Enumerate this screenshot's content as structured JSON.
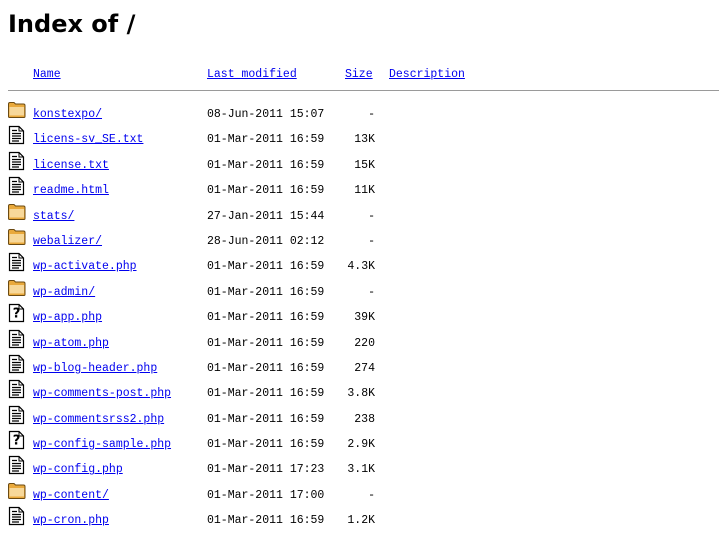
{
  "page_title": "Index of /",
  "columns": {
    "name": "Name",
    "last_modified": "Last modified",
    "size": "Size",
    "description": "Description"
  },
  "entries": [
    {
      "icon": "folder-icon",
      "name": "konstexpo/",
      "date": "08-Jun-2011 15:07",
      "size": "-"
    },
    {
      "icon": "text-file-icon",
      "name": "licens-sv_SE.txt",
      "date": "01-Mar-2011 16:59",
      "size": "13K"
    },
    {
      "icon": "text-file-icon",
      "name": "license.txt",
      "date": "01-Mar-2011 16:59",
      "size": "15K"
    },
    {
      "icon": "text-file-icon",
      "name": "readme.html",
      "date": "01-Mar-2011 16:59",
      "size": "11K"
    },
    {
      "icon": "folder-icon",
      "name": "stats/",
      "date": "27-Jan-2011 15:44",
      "size": "-"
    },
    {
      "icon": "folder-icon",
      "name": "webalizer/",
      "date": "28-Jun-2011 02:12",
      "size": "-"
    },
    {
      "icon": "text-file-icon",
      "name": "wp-activate.php",
      "date": "01-Mar-2011 16:59",
      "size": "4.3K"
    },
    {
      "icon": "folder-icon",
      "name": "wp-admin/",
      "date": "01-Mar-2011 16:59",
      "size": "-"
    },
    {
      "icon": "unknown-file-icon",
      "name": "wp-app.php",
      "date": "01-Mar-2011 16:59",
      "size": "39K"
    },
    {
      "icon": "text-file-icon",
      "name": "wp-atom.php",
      "date": "01-Mar-2011 16:59",
      "size": "220"
    },
    {
      "icon": "text-file-icon",
      "name": "wp-blog-header.php",
      "date": "01-Mar-2011 16:59",
      "size": "274"
    },
    {
      "icon": "text-file-icon",
      "name": "wp-comments-post.php",
      "date": "01-Mar-2011 16:59",
      "size": "3.8K"
    },
    {
      "icon": "text-file-icon",
      "name": "wp-commentsrss2.php",
      "date": "01-Mar-2011 16:59",
      "size": "238"
    },
    {
      "icon": "unknown-file-icon",
      "name": "wp-config-sample.php",
      "date": "01-Mar-2011 16:59",
      "size": "2.9K"
    },
    {
      "icon": "text-file-icon",
      "name": "wp-config.php",
      "date": "01-Mar-2011 17:23",
      "size": "3.1K"
    },
    {
      "icon": "folder-icon",
      "name": "wp-content/",
      "date": "01-Mar-2011 17:00",
      "size": "-"
    },
    {
      "icon": "text-file-icon",
      "name": "wp-cron.php",
      "date": "01-Mar-2011 16:59",
      "size": "1.2K"
    }
  ]
}
